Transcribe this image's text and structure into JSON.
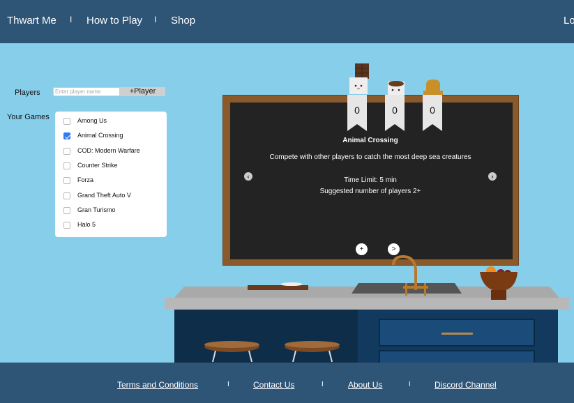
{
  "nav": {
    "brand": "Thwart Me",
    "how_to_play": "How to Play",
    "shop": "Shop",
    "separator": "I",
    "login": "Lo"
  },
  "players": {
    "label": "Players",
    "placeholder": "Enter player name",
    "add_button": "+Player"
  },
  "games": {
    "label": "Your Games",
    "items": [
      {
        "name": "Among Us",
        "checked": false
      },
      {
        "name": "Animal Crossing",
        "checked": true
      },
      {
        "name": "COD: Modern Warfare",
        "checked": false
      },
      {
        "name": "Counter Strike",
        "checked": false
      },
      {
        "name": "Forza",
        "checked": false
      },
      {
        "name": "Grand Theft Auto V",
        "checked": false
      },
      {
        "name": "Gran Turismo",
        "checked": false
      },
      {
        "name": "Halo 5",
        "checked": false
      }
    ]
  },
  "scores": [
    {
      "player": "chocolate",
      "icon": "chocolate-bar-icon",
      "score": "0"
    },
    {
      "player": "cocoa",
      "icon": "hot-cocoa-mug-icon",
      "score": "0"
    },
    {
      "player": "bread",
      "icon": "bread-icon",
      "score": "0"
    }
  ],
  "current_game": {
    "title": "Animal Crossing",
    "description": "Compete with other players to catch the most deep sea creatures",
    "time_limit": "Time Limit: 5 min",
    "suggested_players": "Suggested number of players 2+"
  },
  "board_controls": {
    "prev": "‹",
    "next": "›",
    "add": "+",
    "go": ">"
  },
  "footer": {
    "terms": "Terms and Conditions",
    "contact": "Contact Us",
    "about": "About Us",
    "discord": "Discord Channel",
    "separator": "I"
  },
  "colors": {
    "nav_bg": "#2e5476",
    "page_bg": "#87ceeb",
    "board_frame": "#8b5a2b",
    "board_surface": "#232323",
    "checkbox_accent": "#2f7bf5"
  }
}
